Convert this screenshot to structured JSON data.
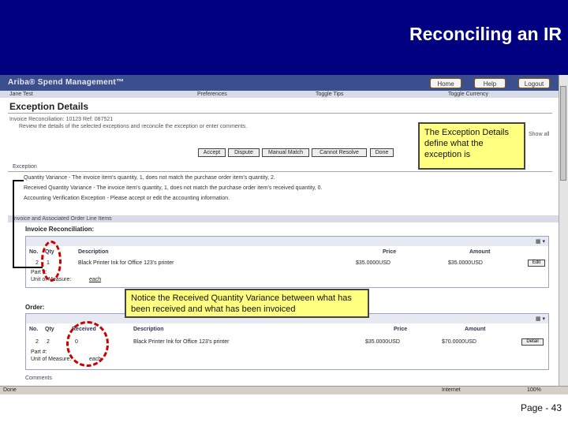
{
  "slide": {
    "title": "Reconciling an IR",
    "page_label": "Page - 43"
  },
  "app": {
    "logo": "Ariba® Spend Management™",
    "nav": {
      "home": "Home",
      "help": "Help",
      "logout": "Logout"
    },
    "user": "Jane Test",
    "links": {
      "preferences": "Preferences",
      "toggle_tips": "Toggle Tips",
      "toggle_currency": "Toggle Currency"
    }
  },
  "page": {
    "title": "Exception Details",
    "invoice_line": "Invoice Reconciliation: 10123   Ref: 087521",
    "instructions": "Review the details of the selected exceptions and reconcile the exception or enter comments.",
    "show_details": "Show all",
    "actions": {
      "accept": "Accept",
      "dispute": "Dispute",
      "manual_match": "Manual Match",
      "cannot_resolve": "Cannot Resolve",
      "done": "Done"
    }
  },
  "exception": {
    "label": "Exception",
    "lines": [
      "Quantity Variance - The invoice item's quantity, 1, does not match the purchase order item's quantity, 2.",
      "Received Quantity Variance - The invoice item's quantity, 1, does not match the purchase order item's received quantity, 0.",
      "Accounting Verification Exception - Please accept or edit the accounting information."
    ]
  },
  "invoice": {
    "band": "Invoice and Associated Order Line Items",
    "title": "Invoice Reconciliation:",
    "headers": {
      "no": "No.",
      "qty": "Qty",
      "description": "Description",
      "price": "Price",
      "amount": "Amount"
    },
    "row": {
      "no": "2",
      "qty": "1",
      "description": "Black Printer Ink for Office 123's printer",
      "price": "$35.0000USD",
      "amount": "$35.0000USD",
      "edit": "Edit"
    },
    "part": "Part #:",
    "unit": "Unit of Measure:",
    "unit_value": "each"
  },
  "order": {
    "title": "Order:",
    "headers": {
      "no": "No.",
      "qty": "Qty",
      "received": "Received",
      "description": "Description",
      "price": "Price",
      "amount": "Amount"
    },
    "row": {
      "no": "2",
      "qty": "2",
      "received": "0",
      "description": "Black Printer Ink for Office 123's printer",
      "price": "$35.0000USD",
      "amount": "$70.0000USD",
      "edit": "Detail"
    },
    "part": "Part #:",
    "unit": "Unit of Measure:",
    "unit_value": "each"
  },
  "comments_label": "Comments",
  "status": {
    "done": "Done",
    "zone": "Internet",
    "zoom": "100%"
  },
  "callouts": {
    "exception_details": "The Exception Details define what the exception is",
    "received_variance": "Notice the Received Quantity Variance between what has been received and what has been invoiced"
  }
}
